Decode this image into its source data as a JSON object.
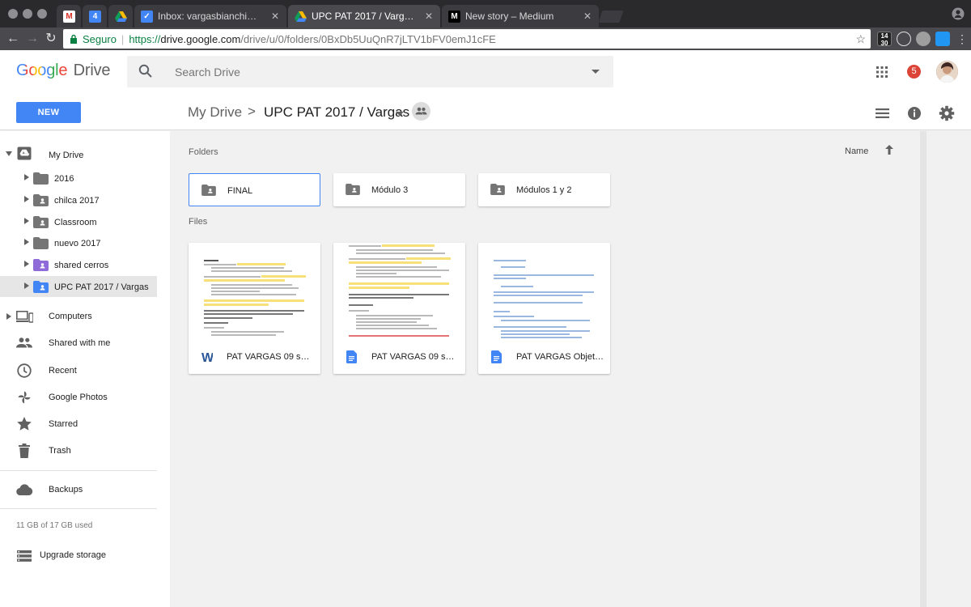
{
  "browser": {
    "tabs": [
      {
        "title": "",
        "favicon": "gmail-icon"
      },
      {
        "title": "",
        "favicon": "calendar-icon",
        "badge": "4"
      },
      {
        "title": "",
        "favicon": "drive-icon"
      },
      {
        "title": "Inbox: vargasbianchi@gmail.com",
        "favicon": "inbox-icon"
      },
      {
        "title": "UPC PAT 2017 / Vargas - Google Drive",
        "favicon": "drive-icon",
        "active": true
      },
      {
        "title": "New story – Medium",
        "favicon": "medium-icon",
        "favicon_text": "M"
      }
    ],
    "address": {
      "secure_label": "Seguro",
      "protocol": "https://",
      "host": "drive.google.com",
      "path": "/drive/u/0/folders/0BxDb5UuQnR7jLTV1bFV0emJ1cFE"
    },
    "extension_date": "14\n30"
  },
  "app": {
    "logo_google": "Google",
    "logo_drive": "Drive",
    "search_placeholder": "Search Drive",
    "notification_count": "5",
    "new_button": "NEW"
  },
  "breadcrumb": {
    "root": "My Drive",
    "separator": ">",
    "current": "UPC PAT 2017 / Vargas"
  },
  "sidebar": {
    "my_drive": "My Drive",
    "tree": [
      {
        "label": "2016",
        "shared": false
      },
      {
        "label": "chilca 2017",
        "shared": true
      },
      {
        "label": "Classroom",
        "shared": true
      },
      {
        "label": "nuevo 2017",
        "shared": false
      },
      {
        "label": "shared cerros",
        "shared": true,
        "color": "#8e6bd8"
      },
      {
        "label": "UPC PAT 2017 / Vargas",
        "shared": true,
        "color": "#4285f4",
        "selected": true
      }
    ],
    "nav": [
      {
        "label": "Computers",
        "icon": "computers-icon"
      },
      {
        "label": "Shared with me",
        "icon": "people-icon"
      },
      {
        "label": "Recent",
        "icon": "clock-icon"
      },
      {
        "label": "Google Photos",
        "icon": "pinwheel-icon"
      },
      {
        "label": "Starred",
        "icon": "star-icon"
      },
      {
        "label": "Trash",
        "icon": "trash-icon"
      }
    ],
    "backups": "Backups",
    "storage": "11 GB of 17 GB used",
    "upgrade": "Upgrade storage"
  },
  "content": {
    "folders_label": "Folders",
    "files_label": "Files",
    "sort_label": "Name",
    "folders": [
      {
        "name": "FINAL",
        "selected": true
      },
      {
        "name": "Módulo 3",
        "selected": false
      },
      {
        "name": "Módulos 1 y 2",
        "selected": false
      }
    ],
    "files": [
      {
        "name": "PAT VARGAS 09 set...",
        "type": "word-icon"
      },
      {
        "name": "PAT VARGAS 09 set...",
        "type": "docs-icon"
      },
      {
        "name": "PAT VARGAS Objeti...",
        "type": "docs-icon"
      }
    ]
  },
  "colors": {
    "accent": "#4285f4",
    "badge_red": "#db4437",
    "secure_green": "#0b8043",
    "selected_bg": "#e6e6e6",
    "highlight": "#f7e07a"
  }
}
